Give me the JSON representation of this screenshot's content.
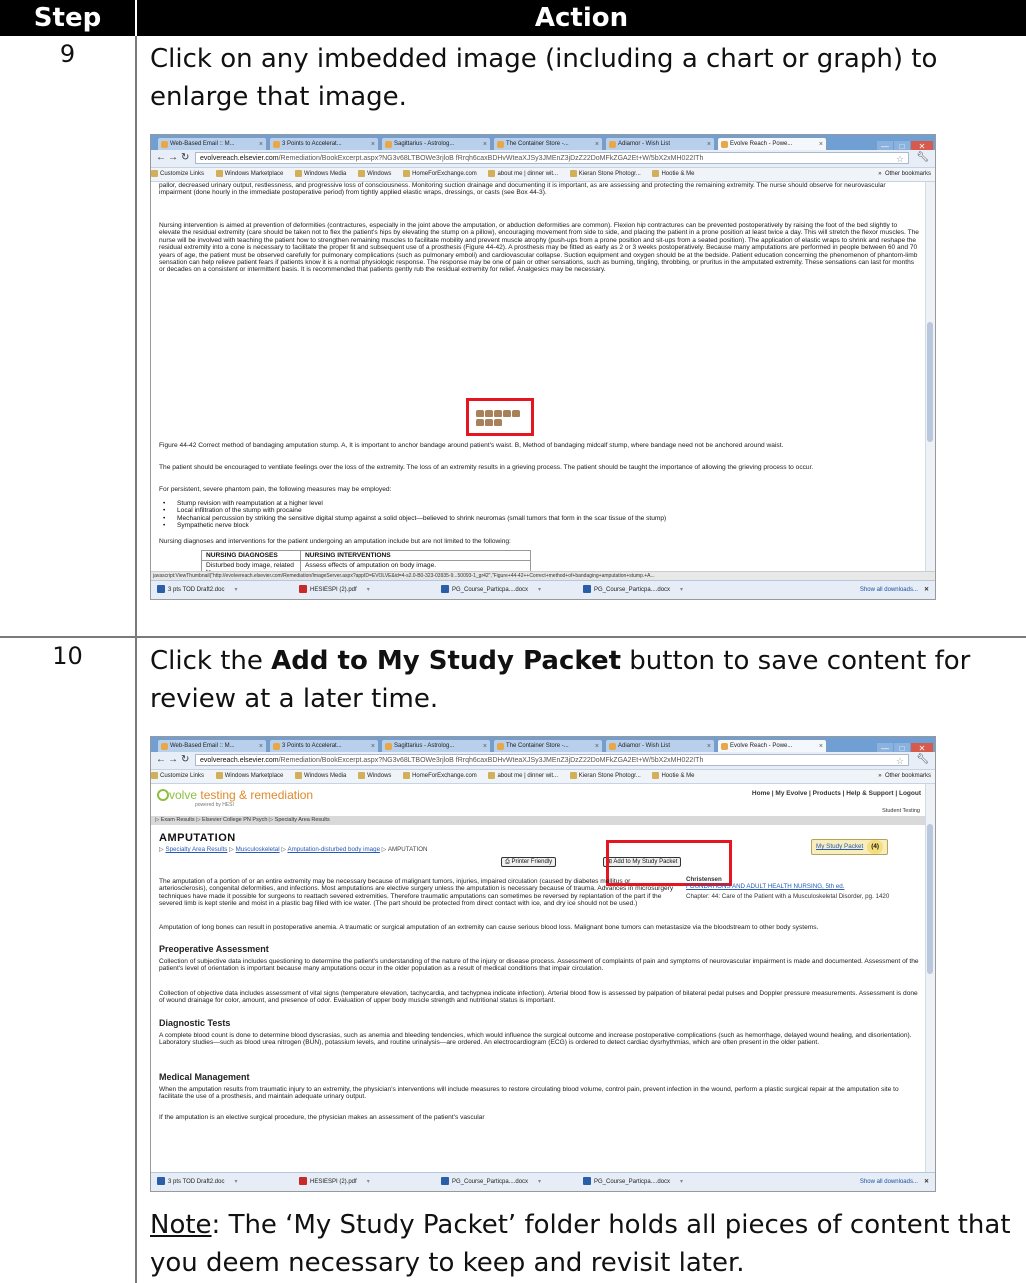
{
  "header": {
    "step": "Step",
    "action": "Action"
  },
  "steps": [
    {
      "number": "9",
      "text": "Click on any imbedded image (including a chart or graph) to enlarge that image."
    },
    {
      "number": "10",
      "text_pre": "Click the ",
      "text_bold": "Add to My Study Packet",
      "text_post": " button to save content for review at a later time.",
      "note_label": "Note",
      "note_text": ": The ‘My Study Packet’ folder holds all pieces of content that you deem necessary to keep and revisit later."
    }
  ],
  "browser": {
    "tabs": [
      "Web-Based Email :: M...",
      "3 Points to Accelerat...",
      "Sagittarius - Astrolog...",
      "The Container Store -...",
      "Adiamor - Wish List",
      "Evolve Reach - Powe..."
    ],
    "url_host": "evolvereach.elsevier.com",
    "url_path": "/Remediation/BookExcerpt.aspx?NG3v68LTBOWe3rjloB fRrqh6caxBDHvWteaXJSy3JMEnZ3jDzZ22DoMFkZGA2Et+W/5bX2xMH022ITh",
    "bookmarks": [
      "Customize Links",
      "Windows Marketplace",
      "Windows Media",
      "Windows",
      "HomeForExchange.com",
      "about me | dinner wit...",
      "Kieran Stone Photogr...",
      "Hootie & Me"
    ],
    "bookmarks_more": "»",
    "other_bookmarks": "Other bookmarks",
    "downloads": [
      "3 pts TOD Draft2.doc",
      "HESIESPI (2).pdf",
      "PG_Course_Particpa....docx",
      "PG_Course_Particpa....docx"
    ],
    "show_all_downloads": "Show all downloads...",
    "close_x": "✕"
  },
  "screenshot1": {
    "para0": "pallor, decreased urinary output, restlessness, and progressive loss of consciousness. Monitoring suction drainage and documenting it is important, as are assessing and protecting the remaining extremity. The nurse should observe for neurovascular impairment (done hourly in the immediate postoperative period) from tightly applied elastic wraps, dressings, or casts (see Box 44-3).",
    "para1": "Nursing intervention is aimed at prevention of deformities (contractures, especially in the joint above the amputation, or abduction deformities are common). Flexion hip contractures can be prevented postoperatively by raising the foot of the bed slightly to elevate the residual extremity (care should be taken not to flex the patient's hips by elevating the stump on a pillow), encouraging movement from side to side, and placing the patient in a prone position at least twice a day. This will stretch the flexor muscles. The nurse will be involved with teaching the patient how to strengthen remaining muscles to facilitate mobility and prevent muscle atrophy (push-ups from a prone position and sit-ups from a seated position). The application of elastic wraps to shrink and reshape the residual extremity into a cone is necessary to facilitate the proper fit and subsequent use of a prosthesis (Figure 44-42). A prosthesis may be fitted as early as 2 or 3 weeks postoperatively. Because many amputations are performed in people between 60 and 70 years of age, the patient must be observed carefully for pulmonary complications (such as pulmonary emboli) and cardiovascular collapse. Suction equipment and oxygen should be at the bedside. Patient education concerning the phenomenon of phantom-limb sensation can help relieve patient fears if patients know it is a normal physiologic response. The response may be one of pain or other sensations, such as burning, tingling, throbbing, or pruritus in the amputated extremity. These sensations can last for months or decades on a consistent or intermittent basis. It is recommended that patients gently rub the residual extremity for relief. Analgesics may be necessary.",
    "caption": "Figure 44-42  Correct method of bandaging amputation stump. A, It is important to anchor bandage around patient's waist. B, Method of bandaging midcalf stump, where bandage need not be anchored around waist.",
    "para2": "The patient should be encouraged to ventilate feelings over the loss of the extremity. The loss of an extremity results in a grieving process. The patient should be taught the importance of allowing the grieving process to occur.",
    "para3": "For persistent, severe phantom pain, the following measures may be employed:",
    "bullets": [
      "Stump revision with reamputation at a higher level",
      "Local infiltration of the stump with procaine",
      "Mechanical percussion by striking the sensitive digital stump against a solid object—believed to shrink neuromas (small tumors that form in the scar tissue of the stump)",
      "Sympathetic nerve block"
    ],
    "para4": "Nursing diagnoses and interventions for the patient undergoing an amputation include but are not limited to the following:",
    "table_h1": "NURSING DIAGNOSES",
    "table_h2": "NURSING INTERVENTIONS",
    "table_r1c1": "Disturbed body image, related to",
    "table_r1c2": "Assess effects of amputation on body image.",
    "status": "javascript:ViewThumbnail(\"http://evolvereach.elsevier.com/Remediation/ImageServer.aspx?appID=EVOLVE&id=4-s2.0-B0-323-03935-9...50093-1_gr42\",\"Figure+44-42++Correct+method+of+bandaging+amputation+stump.+A..."
  },
  "screenshot2": {
    "logo_word": "volve",
    "logo_rest": "testing & remediation",
    "logo_sub": "powered by HESI",
    "topnav": "Home | My Evolve | Products | Help & Support | Logout",
    "student_testing": "Student Testing",
    "crumbbar": "▷ Exam Results  ▷ Elsevier College PN Psych  ▷ Specialty Area Results",
    "title": "AMPUTATION",
    "crumb_links": [
      "Specialty Area Results",
      "Musculoskeletal",
      "Amputation-disturbed body image"
    ],
    "crumb_current": "AMPUTATION",
    "printer_friendly": "Printer Friendly",
    "add_packet": "Add to My Study Packet",
    "my_study_packet": "My Study Packet",
    "packet_count": "(4)",
    "side_author": "Christensen",
    "side_book": "FOUNDATIONS AND ADULT HEALTH NURSING, 5th ed.",
    "side_chapter": "Chapter: 44: Care of the Patient with a Musculoskeletal Disorder, pg. 1420",
    "p1": "The amputation of a portion of or an entire extremity may be necessary because of malignant tumors, injuries, impaired circulation (caused by diabetes mellitus or arteriosclerosis), congenital deformities, and infections. Most amputations are elective surgery unless the amputation is necessary because of trauma. Advances in microsurgery techniques have made it possible for surgeons to reattach severed extremities. Therefore traumatic amputations can sometimes be reversed by replantation of the part if the severed limb is kept sterile and moist in a plastic bag filled with ice water. (The part should be protected from direct contact with ice, and dry ice should not be used.)",
    "p2": "Amputation of long bones can result in postoperative anemia. A traumatic or surgical amputation of an extremity can cause serious blood loss. Malignant bone tumors can metastasize via the bloodstream to other body systems.",
    "h_pre": "Preoperative Assessment",
    "p3": "Collection of subjective data includes questioning to determine the patient's understanding of the nature of the injury or disease process. Assessment of complaints of pain and symptoms of neurovascular impairment is made and documented. Assessment of the patient's level of orientation is important because many amputations occur in the older population as a result of medical conditions that impair circulation.",
    "p4": "Collection of objective data includes assessment of vital signs (temperature elevation, tachycardia, and tachypnea indicate infection). Arterial blood flow is assessed by palpation of bilateral pedal pulses and Doppler pressure measurements. Assessment is done of wound drainage for color, amount, and presence of odor. Evaluation of upper body muscle strength and nutritional status is important.",
    "h_diag": "Diagnostic Tests",
    "p5": "A complete blood count is done to determine blood dyscrasias, such as anemia and bleeding tendencies, which would influence the surgical outcome and increase postoperative complications (such as hemorrhage, delayed wound healing, and disorientation). Laboratory studies—such as blood urea nitrogen (BUN), potassium levels, and routine urinalysis—are ordered. An electrocardiogram (ECG) is ordered to detect cardiac dysrhythmias, which are often present in the older patient.",
    "h_med": "Medical Management",
    "p6": "When the amputation results from traumatic injury to an extremity, the physician's interventions will include measures to restore circulating blood volume, control pain, prevent infection in the wound, perform a plastic surgical repair at the amputation site to facilitate the use of a prosthesis, and maintain adequate urinary output.",
    "p7": "If the amputation is an elective surgical procedure, the physician makes an assessment of the patient's vascular"
  }
}
